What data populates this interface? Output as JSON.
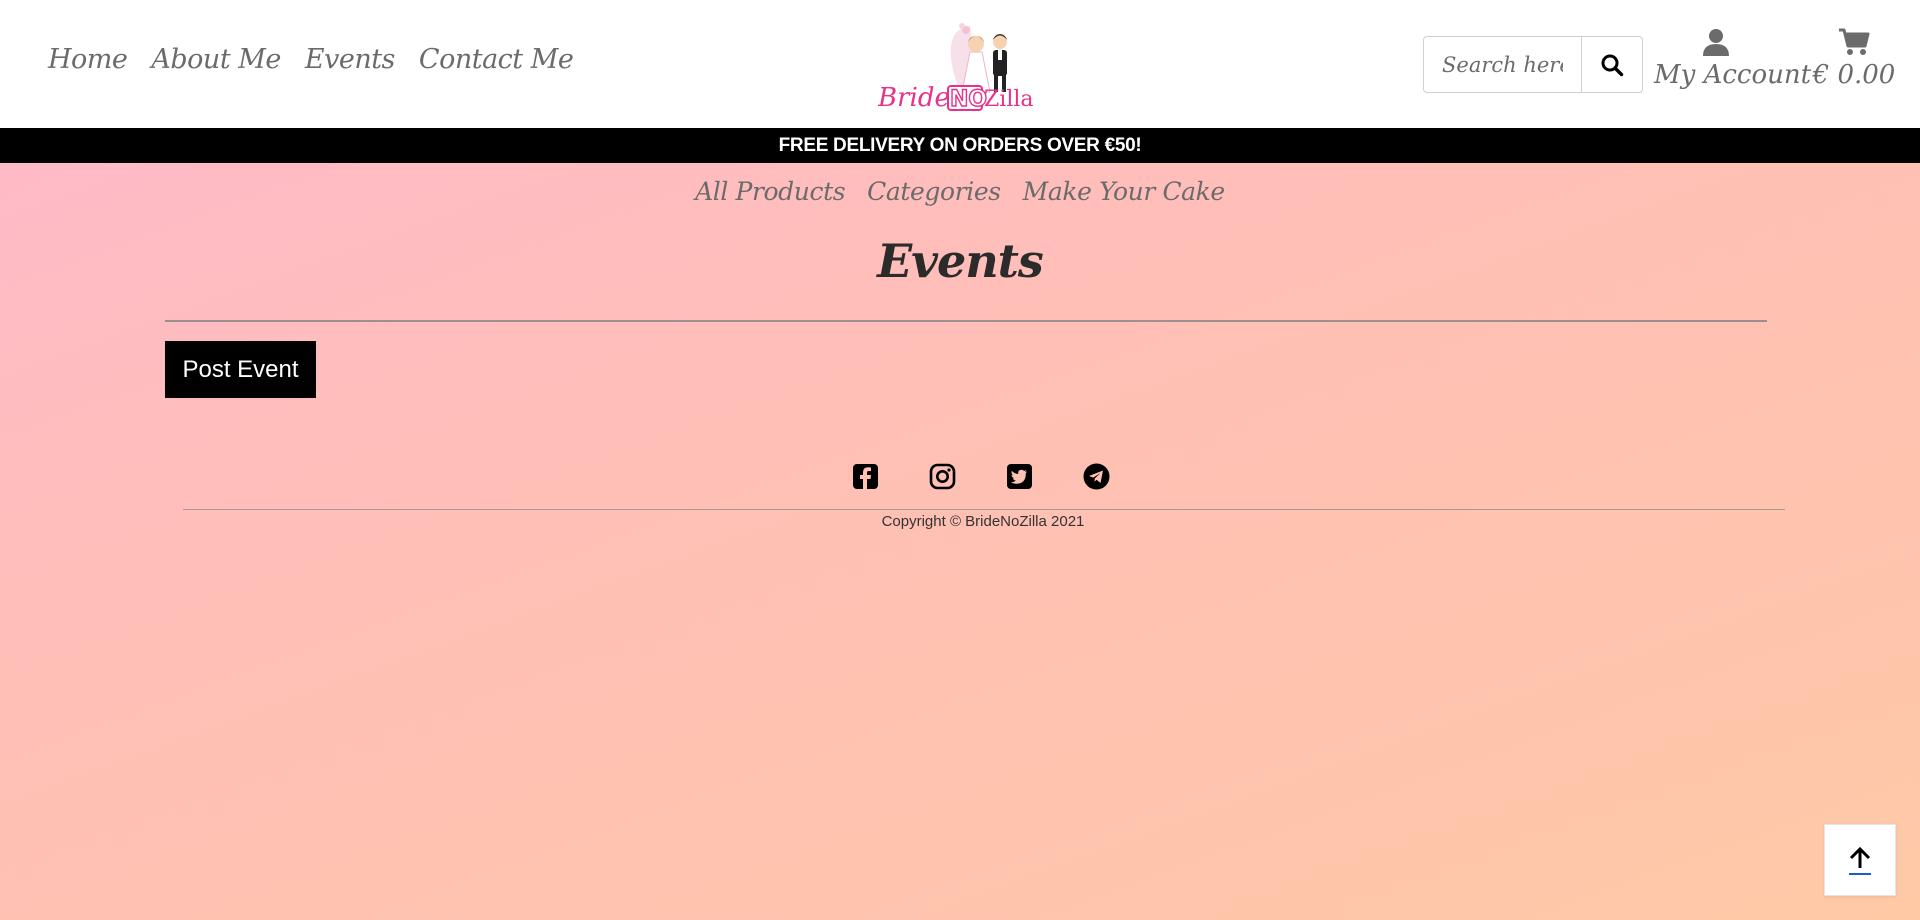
{
  "main_nav": {
    "home": "Home",
    "about": "About Me",
    "events": "Events",
    "contact": "Contact Me"
  },
  "brand": {
    "logo_text_part1": "Bride",
    "logo_text_part2": "NO",
    "logo_text_part3": "Zilla",
    "color": "#e8318a"
  },
  "search": {
    "placeholder": "Search here",
    "icon": "search-icon"
  },
  "account": {
    "label": "My Account",
    "icon": "user-icon"
  },
  "bag": {
    "total": "€ 0.00",
    "icon": "shopping-cart-icon"
  },
  "banner": {
    "text": "FREE DELIVERY ON ORDERS OVER €50!"
  },
  "sub_nav": {
    "all_products": "All Products",
    "categories": "Categories",
    "make_cake": "Make Your Cake"
  },
  "page": {
    "title": "Events",
    "post_button": "Post Event"
  },
  "footer": {
    "socials": [
      "facebook-icon",
      "instagram-icon",
      "twitter-icon",
      "telegram-icon"
    ],
    "copyright": "Copyright © BrideNoZilla 2021"
  },
  "back_to_top": {
    "icon": "arrow-up-icon"
  }
}
